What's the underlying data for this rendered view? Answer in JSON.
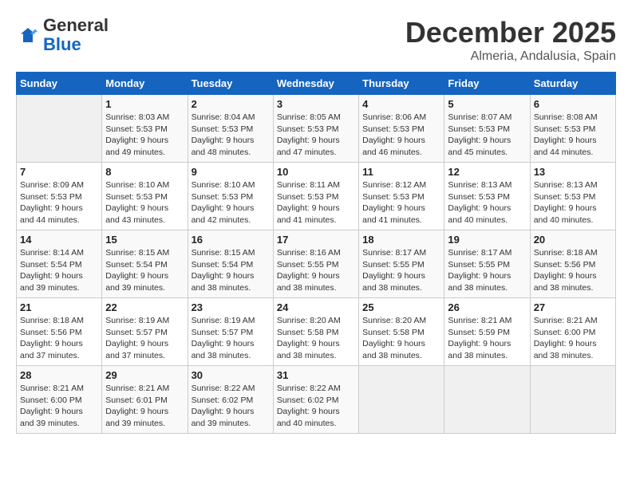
{
  "header": {
    "logo_general": "General",
    "logo_blue": "Blue",
    "month": "December 2025",
    "location": "Almeria, Andalusia, Spain"
  },
  "weekdays": [
    "Sunday",
    "Monday",
    "Tuesday",
    "Wednesday",
    "Thursday",
    "Friday",
    "Saturday"
  ],
  "weeks": [
    [
      {
        "day": null
      },
      {
        "day": "1",
        "sunrise": "Sunrise: 8:03 AM",
        "sunset": "Sunset: 5:53 PM",
        "daylight": "Daylight: 9 hours and 49 minutes."
      },
      {
        "day": "2",
        "sunrise": "Sunrise: 8:04 AM",
        "sunset": "Sunset: 5:53 PM",
        "daylight": "Daylight: 9 hours and 48 minutes."
      },
      {
        "day": "3",
        "sunrise": "Sunrise: 8:05 AM",
        "sunset": "Sunset: 5:53 PM",
        "daylight": "Daylight: 9 hours and 47 minutes."
      },
      {
        "day": "4",
        "sunrise": "Sunrise: 8:06 AM",
        "sunset": "Sunset: 5:53 PM",
        "daylight": "Daylight: 9 hours and 46 minutes."
      },
      {
        "day": "5",
        "sunrise": "Sunrise: 8:07 AM",
        "sunset": "Sunset: 5:53 PM",
        "daylight": "Daylight: 9 hours and 45 minutes."
      },
      {
        "day": "6",
        "sunrise": "Sunrise: 8:08 AM",
        "sunset": "Sunset: 5:53 PM",
        "daylight": "Daylight: 9 hours and 44 minutes."
      }
    ],
    [
      {
        "day": "7",
        "sunrise": "Sunrise: 8:09 AM",
        "sunset": "Sunset: 5:53 PM",
        "daylight": "Daylight: 9 hours and 44 minutes."
      },
      {
        "day": "8",
        "sunrise": "Sunrise: 8:10 AM",
        "sunset": "Sunset: 5:53 PM",
        "daylight": "Daylight: 9 hours and 43 minutes."
      },
      {
        "day": "9",
        "sunrise": "Sunrise: 8:10 AM",
        "sunset": "Sunset: 5:53 PM",
        "daylight": "Daylight: 9 hours and 42 minutes."
      },
      {
        "day": "10",
        "sunrise": "Sunrise: 8:11 AM",
        "sunset": "Sunset: 5:53 PM",
        "daylight": "Daylight: 9 hours and 41 minutes."
      },
      {
        "day": "11",
        "sunrise": "Sunrise: 8:12 AM",
        "sunset": "Sunset: 5:53 PM",
        "daylight": "Daylight: 9 hours and 41 minutes."
      },
      {
        "day": "12",
        "sunrise": "Sunrise: 8:13 AM",
        "sunset": "Sunset: 5:53 PM",
        "daylight": "Daylight: 9 hours and 40 minutes."
      },
      {
        "day": "13",
        "sunrise": "Sunrise: 8:13 AM",
        "sunset": "Sunset: 5:53 PM",
        "daylight": "Daylight: 9 hours and 40 minutes."
      }
    ],
    [
      {
        "day": "14",
        "sunrise": "Sunrise: 8:14 AM",
        "sunset": "Sunset: 5:54 PM",
        "daylight": "Daylight: 9 hours and 39 minutes."
      },
      {
        "day": "15",
        "sunrise": "Sunrise: 8:15 AM",
        "sunset": "Sunset: 5:54 PM",
        "daylight": "Daylight: 9 hours and 39 minutes."
      },
      {
        "day": "16",
        "sunrise": "Sunrise: 8:15 AM",
        "sunset": "Sunset: 5:54 PM",
        "daylight": "Daylight: 9 hours and 38 minutes."
      },
      {
        "day": "17",
        "sunrise": "Sunrise: 8:16 AM",
        "sunset": "Sunset: 5:55 PM",
        "daylight": "Daylight: 9 hours and 38 minutes."
      },
      {
        "day": "18",
        "sunrise": "Sunrise: 8:17 AM",
        "sunset": "Sunset: 5:55 PM",
        "daylight": "Daylight: 9 hours and 38 minutes."
      },
      {
        "day": "19",
        "sunrise": "Sunrise: 8:17 AM",
        "sunset": "Sunset: 5:55 PM",
        "daylight": "Daylight: 9 hours and 38 minutes."
      },
      {
        "day": "20",
        "sunrise": "Sunrise: 8:18 AM",
        "sunset": "Sunset: 5:56 PM",
        "daylight": "Daylight: 9 hours and 38 minutes."
      }
    ],
    [
      {
        "day": "21",
        "sunrise": "Sunrise: 8:18 AM",
        "sunset": "Sunset: 5:56 PM",
        "daylight": "Daylight: 9 hours and 37 minutes."
      },
      {
        "day": "22",
        "sunrise": "Sunrise: 8:19 AM",
        "sunset": "Sunset: 5:57 PM",
        "daylight": "Daylight: 9 hours and 37 minutes."
      },
      {
        "day": "23",
        "sunrise": "Sunrise: 8:19 AM",
        "sunset": "Sunset: 5:57 PM",
        "daylight": "Daylight: 9 hours and 38 minutes."
      },
      {
        "day": "24",
        "sunrise": "Sunrise: 8:20 AM",
        "sunset": "Sunset: 5:58 PM",
        "daylight": "Daylight: 9 hours and 38 minutes."
      },
      {
        "day": "25",
        "sunrise": "Sunrise: 8:20 AM",
        "sunset": "Sunset: 5:58 PM",
        "daylight": "Daylight: 9 hours and 38 minutes."
      },
      {
        "day": "26",
        "sunrise": "Sunrise: 8:21 AM",
        "sunset": "Sunset: 5:59 PM",
        "daylight": "Daylight: 9 hours and 38 minutes."
      },
      {
        "day": "27",
        "sunrise": "Sunrise: 8:21 AM",
        "sunset": "Sunset: 6:00 PM",
        "daylight": "Daylight: 9 hours and 38 minutes."
      }
    ],
    [
      {
        "day": "28",
        "sunrise": "Sunrise: 8:21 AM",
        "sunset": "Sunset: 6:00 PM",
        "daylight": "Daylight: 9 hours and 39 minutes."
      },
      {
        "day": "29",
        "sunrise": "Sunrise: 8:21 AM",
        "sunset": "Sunset: 6:01 PM",
        "daylight": "Daylight: 9 hours and 39 minutes."
      },
      {
        "day": "30",
        "sunrise": "Sunrise: 8:22 AM",
        "sunset": "Sunset: 6:02 PM",
        "daylight": "Daylight: 9 hours and 39 minutes."
      },
      {
        "day": "31",
        "sunrise": "Sunrise: 8:22 AM",
        "sunset": "Sunset: 6:02 PM",
        "daylight": "Daylight: 9 hours and 40 minutes."
      },
      {
        "day": null
      },
      {
        "day": null
      },
      {
        "day": null
      }
    ]
  ]
}
